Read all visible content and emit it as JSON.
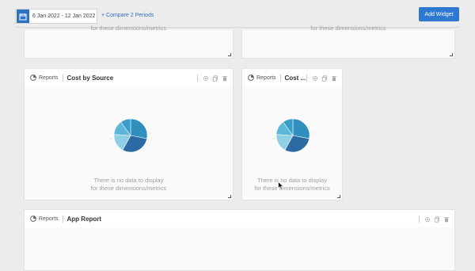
{
  "toolbar": {
    "date_range": "6 Jan 2022 - 12 Jan 2022",
    "compare_label": "+ Compare 2 Periods",
    "add_widget_label": "Add Widget"
  },
  "widgets": [
    {
      "id": "top-left",
      "nodata_line2": "for these dimensions/metrics"
    },
    {
      "id": "top-right",
      "nodata_line2": "for these dimensions/metrics"
    },
    {
      "id": "cost-by-source",
      "section": "Reports",
      "title": "Cost by Source",
      "nodata_line1": "There is no data to display",
      "nodata_line2": "for these dimensions/metrics"
    },
    {
      "id": "cost-truncated",
      "section": "Reports",
      "title": "Cost ...",
      "nodata_line1": "There is no data to display",
      "nodata_line2": "for these dimensions/metrics"
    },
    {
      "id": "app-report",
      "section": "Reports",
      "title": "App Report"
    }
  ],
  "icons": {
    "calendar": "calendar-icon",
    "reports": "pie-chart-icon",
    "settings": "gear-icon",
    "copy": "copy-icon",
    "delete": "trash-icon",
    "resize": "resize-handle-icon",
    "cursor": "mouse-cursor-icon"
  },
  "colors": {
    "accent": "#2d79cf",
    "pie": [
      "#2f8fbe",
      "#2c6aa3",
      "#8fd0e6",
      "#5bb8d8",
      "#3a9cc8"
    ]
  }
}
